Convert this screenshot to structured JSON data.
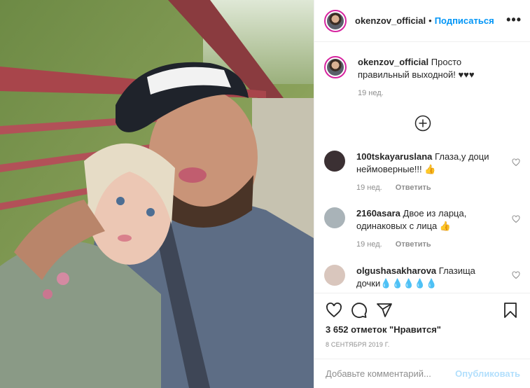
{
  "header": {
    "username": "okenzov_official",
    "separator": "•",
    "follow_label": "Подписаться",
    "more_icon": "ellipsis-icon",
    "more_label": "•••"
  },
  "caption": {
    "username": "okenzov_official",
    "text": "Просто правильный выходной! ♥♥♥",
    "time": "19 нед."
  },
  "load_more_icon": "plus-circle-icon",
  "comments": [
    {
      "username": "100tskayaruslana",
      "text": "Глаза,у доци неймоверные!!! 👍",
      "time": "19 нед.",
      "reply": "Ответить",
      "avatar_color": "#3b3033"
    },
    {
      "username": "2160asara",
      "text": "Двое из ларца, одинаковых с лица 👍",
      "time": "19 нед.",
      "reply": "Ответить",
      "avatar_color": "#a9b3b8"
    },
    {
      "username": "olgushasakharova",
      "text": "Глазища дочки💧💧💧💧💧",
      "time": "",
      "reply": "",
      "avatar_color": "#d9c6bd"
    }
  ],
  "actions": {
    "like_icon": "heart-icon",
    "comment_icon": "comment-icon",
    "share_icon": "send-icon",
    "save_icon": "bookmark-icon"
  },
  "likes_text": "3 652 отметок \"Нравится\"",
  "date_text": "8 СЕНТЯБРЯ 2019 Г.",
  "comment_input": {
    "placeholder": "Добавьте комментарий...",
    "value": ""
  },
  "publish_label": "Опубликовать",
  "colors": {
    "accent": "#0095f6",
    "publish_disabled": "#b2dffc",
    "muted": "#8e8e8e"
  }
}
